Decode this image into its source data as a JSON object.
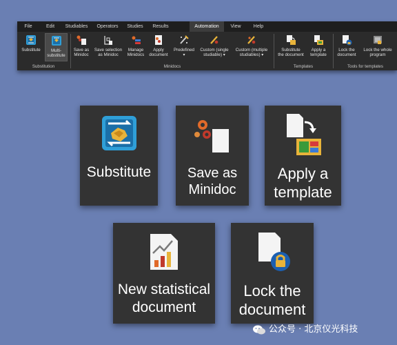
{
  "colors": {
    "background": "#6a7fb3",
    "ribbon": "#2b2b2b",
    "menubar": "#1e1e1e",
    "tile": "#333333",
    "active_tab": "#3c3c3c"
  },
  "menu": {
    "items": [
      "File",
      "Edit",
      "Studiables",
      "Operators",
      "Studies",
      "Results",
      "Automation",
      "View",
      "Help"
    ],
    "active": "Automation"
  },
  "ribbon": {
    "buttons": [
      {
        "label": "Substitute",
        "icon": "substitute-icon"
      },
      {
        "label": "Multi-\nsubstitute",
        "icon": "multi-substitute-icon",
        "selected": true
      },
      {
        "label": "Save as\nMinidoc",
        "icon": "save-minidoc-icon"
      },
      {
        "label": "Save selection\nas Minidoc",
        "icon": "save-selection-icon"
      },
      {
        "label": "Manage\nMinidocs",
        "icon": "manage-minidocs-icon"
      },
      {
        "label": "Apply\ndocument",
        "icon": "apply-document-icon"
      },
      {
        "label": "Predefined\n▾",
        "icon": "predefined-icon"
      },
      {
        "label": "Custom (single\nstudiable) ▾",
        "icon": "custom-single-icon"
      },
      {
        "label": "Custom (multiple\nstudiables) ▾",
        "icon": "custom-multiple-icon"
      },
      {
        "label": "Substitute\nthe document",
        "icon": "substitute-document-icon"
      },
      {
        "label": "Apply a\ntemplate",
        "icon": "apply-template-icon"
      },
      {
        "label": "Lock the\ndocument",
        "icon": "lock-document-icon"
      },
      {
        "label": "Lock the whole\nprogram",
        "icon": "lock-program-icon"
      }
    ],
    "groups": [
      "Substitution",
      "Minidocs",
      "Templates",
      "Tools for templates"
    ]
  },
  "tiles": [
    {
      "label": "Substitute",
      "icon": "substitute-icon"
    },
    {
      "label": "Save as\nMinidoc",
      "icon": "save-minidoc-icon"
    },
    {
      "label": "Apply a\ntemplate",
      "icon": "apply-template-icon"
    },
    {
      "label": "New statistical\ndocument",
      "icon": "statistical-document-icon"
    },
    {
      "label": "Lock the\ndocument",
      "icon": "lock-document-icon"
    }
  ],
  "watermark": {
    "text": "公众号 · 北京仪光科技",
    "icon": "wechat-icon"
  }
}
